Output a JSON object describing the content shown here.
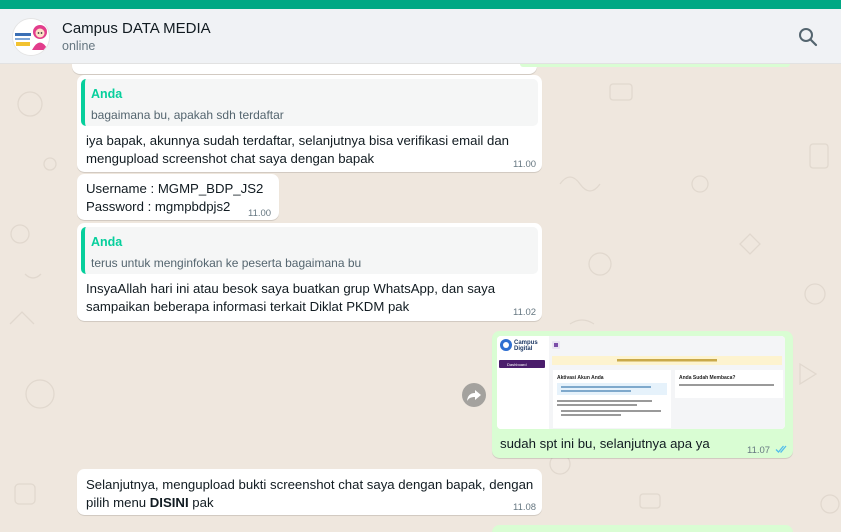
{
  "chat": {
    "contact_name": "Campus DATA MEDIA",
    "status": "online"
  },
  "messages": [
    {
      "direction": "in",
      "quoted": {
        "author": "Anda",
        "text": "bagaimana bu, apakah sdh terdaftar"
      },
      "lines": [
        "iya bapak, akunnya sudah terdaftar, selanjutnya bisa verifikasi email dan",
        "mengupload screenshot chat saya dengan bapak"
      ],
      "time": "11.00"
    },
    {
      "direction": "in",
      "lines": [
        "Username : MGMP_BDP_JS2",
        "Password : mgmpbdpjs2"
      ],
      "time": "11.00"
    },
    {
      "direction": "in",
      "quoted": {
        "author": "Anda",
        "text": "terus untuk menginfokan ke peserta bagaimana bu"
      },
      "lines": [
        "InsyaAllah hari ini atau besok saya buatkan grup WhatsApp, dan saya",
        "sampaikan beberapa informasi terkait Diklat PKDM pak"
      ],
      "time": "11.02"
    },
    {
      "direction": "out",
      "caption": "sudah spt ini bu, selanjutnya apa ya",
      "time": "11.07",
      "read": true,
      "image": {
        "logo_title": "Campus",
        "logo_subtitle": "Digital",
        "sidebar_item": "Dashboard",
        "card_left_title": "Aktivasi Akun Anda",
        "card_right_title": "Anda Sudah Membaca?"
      }
    },
    {
      "direction": "in",
      "line1": "Selanjutnya, mengupload bukti screenshot chat saya dengan bapak, dengan",
      "line2_prefix": "pilih menu ",
      "line2_bold": "DISINI",
      "line2_suffix": " pak",
      "time": "11.08"
    }
  ],
  "colors": {
    "accent": "#00a884",
    "incoming_bubble": "#ffffff",
    "outgoing_bubble": "#d9fdd3",
    "quote_author": "#06cf9c",
    "read_ticks": "#53bdeb"
  },
  "icons": {
    "search": "search-icon",
    "forward": "forward-icon",
    "read_receipt": "double-check-icon"
  }
}
